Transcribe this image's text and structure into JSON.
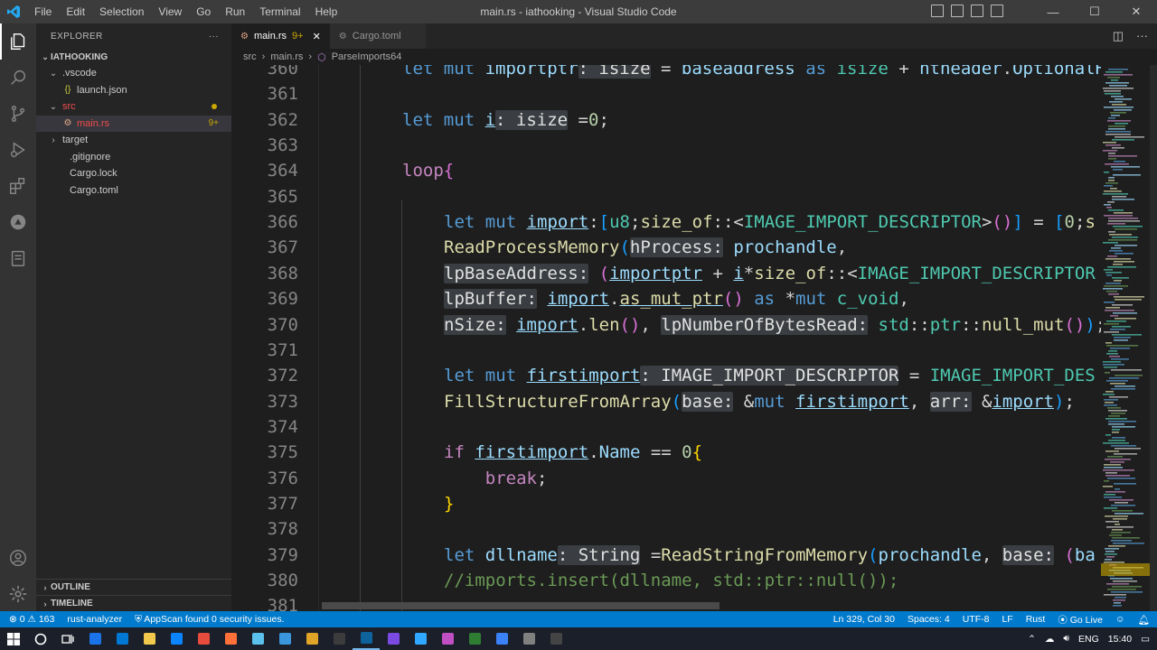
{
  "titlebar": {
    "menu": [
      "File",
      "Edit",
      "Selection",
      "View",
      "Go",
      "Run",
      "Terminal",
      "Help"
    ],
    "title": "main.rs - iathooking - Visual Studio Code",
    "controls": {
      "minimize": "—",
      "maximize": "☐",
      "close": "✕"
    }
  },
  "explorer": {
    "header": "EXPLORER",
    "more": "···",
    "project": "IATHOOKING",
    "items": [
      {
        "label": ".vscode",
        "depth": 1,
        "type": "folder-open"
      },
      {
        "label": "launch.json",
        "depth": 2,
        "type": "json",
        "icon_text": "{}"
      },
      {
        "label": "src",
        "depth": 1,
        "type": "folder-open",
        "color": "#f14c4c",
        "dot": true
      },
      {
        "label": "main.rs",
        "depth": 2,
        "type": "rust",
        "color": "#f14c4c",
        "badge": "9+",
        "selected": true
      },
      {
        "label": "target",
        "depth": 1,
        "type": "folder-closed"
      },
      {
        "label": ".gitignore",
        "depth": 1,
        "type": "file"
      },
      {
        "label": "Cargo.lock",
        "depth": 1,
        "type": "file"
      },
      {
        "label": "Cargo.toml",
        "depth": 1,
        "type": "file"
      }
    ],
    "outline": "OUTLINE",
    "timeline": "TIMELINE"
  },
  "tabs": [
    {
      "label": "main.rs",
      "modified": "9+",
      "close": "✕",
      "active": true
    },
    {
      "label": "Cargo.toml",
      "active": false
    }
  ],
  "breadcrumbs": {
    "folder": "src",
    "file": "main.rs",
    "symbol": "ParseImports64",
    "sep": "›"
  },
  "code": {
    "lines": [
      {
        "num": "360",
        "html": "<span class=\"k\">let</span> <span class=\"k\">mut</span> <span class=\"v\">importptr</span><span class=\"h\">: isize</span> = <span class=\"v\">baseaddress</span> <span class=\"k\">as</span> <span class=\"t\">isize</span> + <span class=\"v\">ntheader</span>.<span class=\"v\">OptionalH</span>",
        "indent": 1
      },
      {
        "num": "361",
        "html": "",
        "indent": 1
      },
      {
        "num": "362",
        "html": "<span class=\"k\">let</span> <span class=\"k\">mut</span> <span class=\"v u\">i</span><span class=\"h\">: isize</span> =<span class=\"n\">0</span>;",
        "indent": 1
      },
      {
        "num": "363",
        "html": "",
        "indent": 1
      },
      {
        "num": "364",
        "html": "<span class=\"c\">loop</span><span class=\"p2\">{</span>",
        "indent": 1
      },
      {
        "num": "365",
        "html": "",
        "indent": 2
      },
      {
        "num": "366",
        "html": "<span class=\"k\">let</span> <span class=\"k\">mut</span> <span class=\"v u\">import</span>:<span class=\"p3\">[</span><span class=\"t\">u8</span>;<span class=\"f\">size_of</span>::&lt;<span class=\"t\">IMAGE_IMPORT_DESCRIPTOR</span>&gt;<span class=\"p2\">()</span><span class=\"p3\">]</span> = <span class=\"p3\">[</span><span class=\"n\">0</span>;<span class=\"f\">s</span>",
        "indent": 2
      },
      {
        "num": "367",
        "html": "<span class=\"f\">ReadProcessMemory</span><span class=\"p3\">(</span><span class=\"h\">hProcess:</span> <span class=\"v\">prochandle</span>,",
        "indent": 2
      },
      {
        "num": "368",
        "html": "<span class=\"h\">lpBaseAddress:</span> <span class=\"p2\">(</span><span class=\"v u\">importptr</span> + <span class=\"v u\">i</span>*<span class=\"f\">size_of</span>::&lt;<span class=\"t\">IMAGE_IMPORT_DESCRIPTOR</span>",
        "indent": 2
      },
      {
        "num": "369",
        "html": "<span class=\"h\">lpBuffer:</span> <span class=\"v u\">import</span>.<span class=\"f u\">as_mut_ptr</span><span class=\"p2\">()</span> <span class=\"k\">as</span> *<span class=\"k\">mut</span> <span class=\"t\">c_void</span>,",
        "indent": 2
      },
      {
        "num": "370",
        "html": "<span class=\"h\">nSize:</span> <span class=\"v u\">import</span>.<span class=\"f\">len</span><span class=\"p2\">()</span>, <span class=\"h\">lpNumberOfBytesRead:</span> <span class=\"t\">std</span>::<span class=\"t\">ptr</span>::<span class=\"f\">null_mut</span><span class=\"p2\">()</span><span class=\"p3\">)</span>;",
        "indent": 2
      },
      {
        "num": "371",
        "html": "",
        "indent": 2
      },
      {
        "num": "372",
        "html": "<span class=\"k\">let</span> <span class=\"k\">mut</span> <span class=\"v u\">firstimport</span><span class=\"h\">: IMAGE_IMPORT_DESCRIPTOR</span> = <span class=\"t\">IMAGE_IMPORT_DES</span>",
        "indent": 2
      },
      {
        "num": "373",
        "html": "<span class=\"f\">FillStructureFromArray</span><span class=\"p3\">(</span><span class=\"h\">base:</span> &amp;<span class=\"k\">mut</span> <span class=\"v u\">firstimport</span>, <span class=\"h\">arr:</span> &amp;<span class=\"v u\">import</span><span class=\"p3\">)</span>;",
        "indent": 2
      },
      {
        "num": "374",
        "html": "",
        "indent": 2
      },
      {
        "num": "375",
        "html": "<span class=\"c\">if</span> <span class=\"v u\">firstimport</span>.<span class=\"v\">Name</span> == <span class=\"n\">0</span><span class=\"p1\">{</span>",
        "indent": 2
      },
      {
        "num": "376",
        "html": "    <span class=\"c\">break</span>;",
        "indent": 3
      },
      {
        "num": "377",
        "html": "<span class=\"p1\">}</span>",
        "indent": 2
      },
      {
        "num": "378",
        "html": "",
        "indent": 2
      },
      {
        "num": "379",
        "html": "<span class=\"k\">let</span> <span class=\"v\">dllname</span><span class=\"h\">: String</span> =<span class=\"f\">ReadStringFromMemory</span><span class=\"p3\">(</span><span class=\"v\">prochandle</span>, <span class=\"h\">base:</span> <span class=\"p2\">(</span><span class=\"v\">ba</span>",
        "indent": 2
      },
      {
        "num": "380",
        "html": "<span class=\"cm\">//imports.insert(dllname, std::ptr::null());</span>",
        "indent": 2
      },
      {
        "num": "381",
        "html": "",
        "indent": 2
      }
    ]
  },
  "status": {
    "errors": "0",
    "warnings": "163",
    "analyzer": "rust-analyzer",
    "appscan": "AppScan found 0 security issues.",
    "position": "Ln 329, Col 30",
    "spaces": "Spaces: 4",
    "encoding": "UTF-8",
    "eol": "LF",
    "language": "Rust",
    "golive": "Go Live"
  },
  "taskbar": {
    "lang": "ENG",
    "time": "15:40",
    "apps": [
      "#1a73e8",
      "#0078d4",
      "#f2c94c",
      "#0a84ff",
      "#e74c3c",
      "#ff7139",
      "#5bc0eb",
      "#3a96dd",
      "#e0a526",
      "#3c3c3c",
      "#0e639c",
      "#7b4ae2",
      "#31a8ff",
      "#c04fc4",
      "#2e7d32",
      "#3b82f6",
      "#808080",
      "#444"
    ]
  },
  "colors": {
    "accent": "#007acc",
    "modified": "#cca700",
    "error": "#f14c4c"
  }
}
